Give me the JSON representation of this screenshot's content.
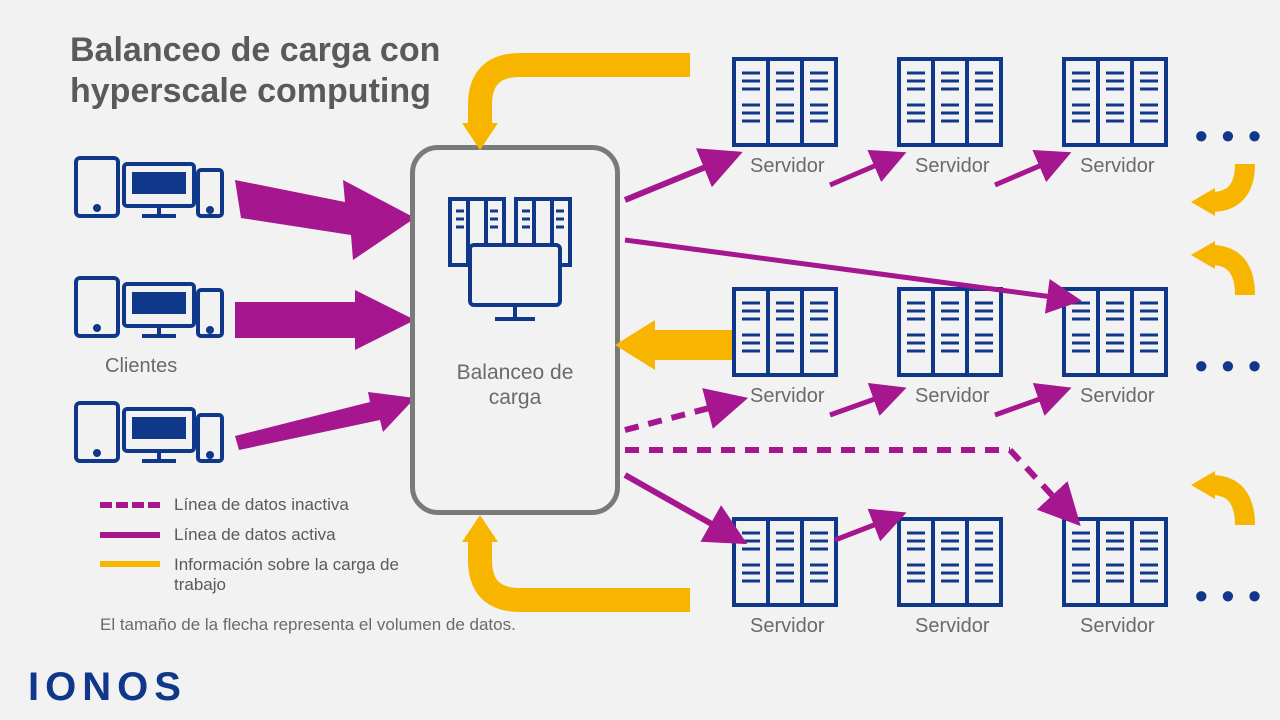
{
  "title_line1": "Balanceo de carga con",
  "title_line2": "hyperscale computing",
  "labels": {
    "clients": "Clientes",
    "load_balancer_line1": "Balanceo de",
    "load_balancer_line2": "carga",
    "server": "Servidor"
  },
  "legend": {
    "inactive": "Línea de datos inactiva",
    "active": "Línea de datos activa",
    "workload": "Información sobre la carga de trabajo"
  },
  "caption": "El tamaño de la flecha representa el volumen de datos.",
  "brand": "IONOS",
  "colors": {
    "blue": "#10388a",
    "magenta": "#a5168f",
    "yellow": "#f7b500",
    "gray": "#7a7a7a"
  },
  "ellipsis": "• • •"
}
